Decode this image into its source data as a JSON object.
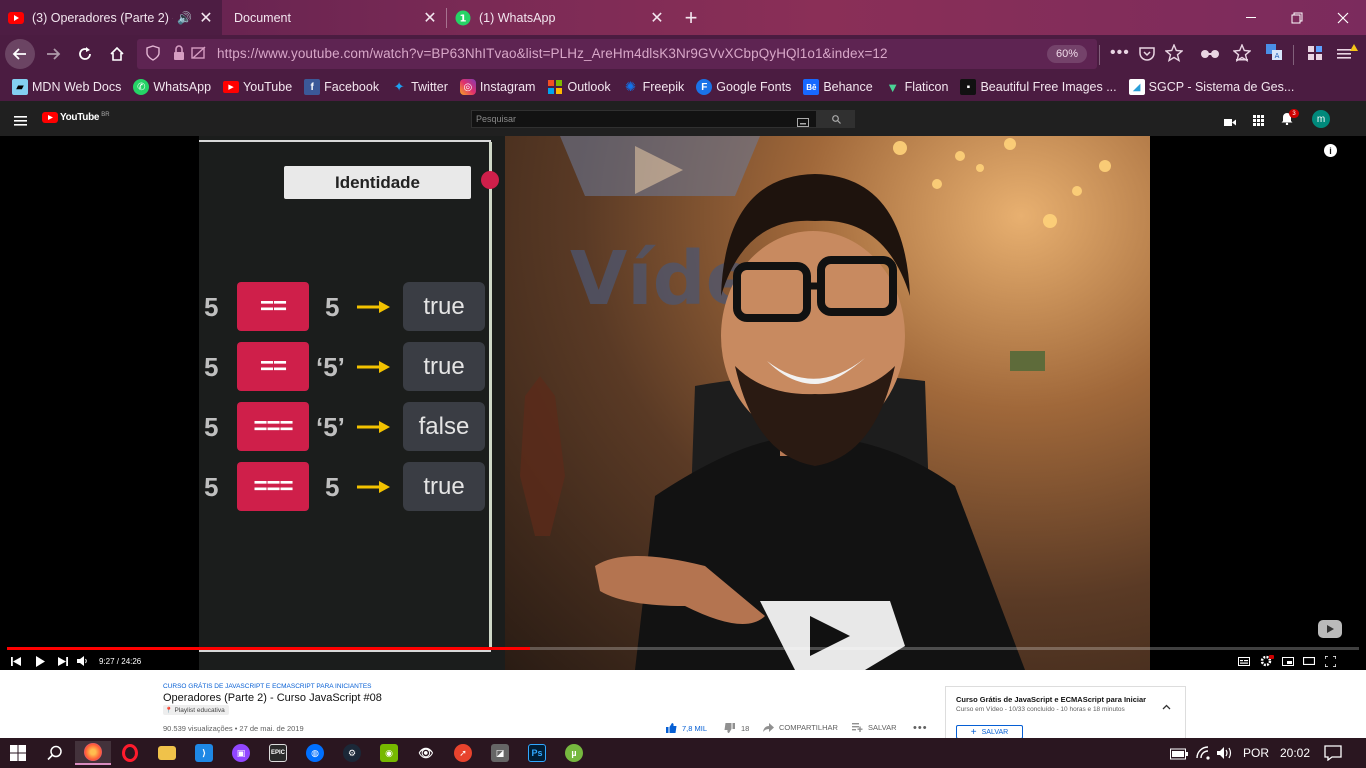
{
  "colors": {
    "accent_red": "#cf1f4a",
    "yt_red": "#ff0000",
    "arrow_yellow": "#f2c200"
  },
  "tabs": [
    {
      "label": "(3) Operadores (Parte 2) - C",
      "icon": "youtube-icon",
      "active": true
    },
    {
      "label": "Document",
      "icon": "",
      "active": false
    },
    {
      "label": "(1) WhatsApp",
      "icon": "whatsapp-icon",
      "active": false
    }
  ],
  "tabbar": {
    "new_tab": "+",
    "close": "✕"
  },
  "nav": {
    "url": "https://www.youtube.com/watch?v=BP63NhITvao&list=PLHz_AreHm4dlsK3Nr9GVvXCbpQyHQl1o1&index=12",
    "zoom": "60%"
  },
  "bookmarks": [
    {
      "label": "MDN Web Docs",
      "icon": "mdn-icon"
    },
    {
      "label": "WhatsApp",
      "icon": "whatsapp-icon"
    },
    {
      "label": "YouTube",
      "icon": "youtube-icon"
    },
    {
      "label": "Facebook",
      "icon": "facebook-icon"
    },
    {
      "label": "Twitter",
      "icon": "twitter-icon"
    },
    {
      "label": "Instagram",
      "icon": "instagram-icon"
    },
    {
      "label": "Outlook",
      "icon": "outlook-icon"
    },
    {
      "label": "Freepik",
      "icon": "freepik-icon"
    },
    {
      "label": "Google Fonts",
      "icon": "google-fonts-icon"
    },
    {
      "label": "Behance",
      "icon": "behance-icon"
    },
    {
      "label": "Flaticon",
      "icon": "flaticon-icon"
    },
    {
      "label": "Beautiful Free Images ...",
      "icon": "unsplash-icon"
    },
    {
      "label": "SGCP - Sistema de Ges...",
      "icon": "sgcp-icon"
    }
  ],
  "yt": {
    "logo": "YouTube",
    "region": "BR",
    "search_placeholder": "Pesquisar",
    "notifications": "3",
    "avatar": "m"
  },
  "slide": {
    "title": "Identidade",
    "rows": [
      {
        "left": "5",
        "op": "==",
        "right": "5",
        "result": "true"
      },
      {
        "left": "5",
        "op": "==",
        "right": "‘5’",
        "result": "true"
      },
      {
        "left": "5",
        "op": "===",
        "right": "‘5’",
        "result": "false"
      },
      {
        "left": "5",
        "op": "===",
        "right": "5",
        "result": "true"
      }
    ],
    "logo_text": "Vídeo"
  },
  "player": {
    "time": "9:27 / 24:26",
    "progress": 0.387
  },
  "video_info": {
    "playlist_label": "CURSO GRÁTIS DE JAVASCRIPT E ECMASCRIPT PARA INICIANTES",
    "title": "Operadores (Parte 2) - Curso JavaScript #08",
    "badge": "Playlist educativa",
    "meta": "90.539 visualizações • 27 de mai. de 2019",
    "likes": "7,8 MIL",
    "dislikes": "18",
    "share": "COMPARTILHAR",
    "save": "SALVAR"
  },
  "playlist_panel": {
    "title": "Curso Grátis de JavaScript e ECMAScript para Iniciar",
    "subtitle": "Curso em Vídeo - 10/33 concluído - 10 horas e 18 minutos",
    "save": "SALVAR"
  },
  "taskbar": {
    "lang": "POR",
    "time": "20:02"
  }
}
